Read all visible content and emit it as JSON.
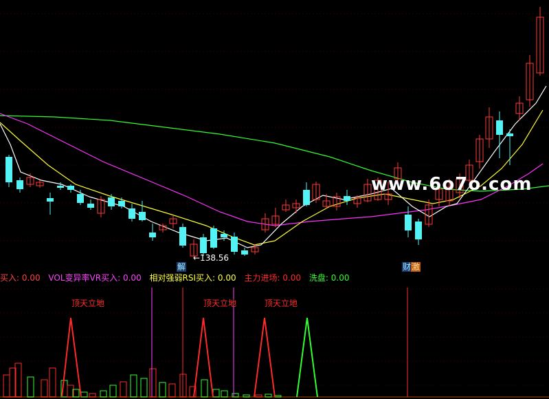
{
  "indicators": {
    "item1": {
      "label": "买入:",
      "value": "0.00"
    },
    "item2": {
      "label": "VOL变异率VR买入:",
      "value": "0.00"
    },
    "item3": {
      "label": "相对强弱RSI买入:",
      "value": "0.00"
    },
    "item4": {
      "label": "主力进场:",
      "value": "0.00"
    },
    "item5": {
      "label": "洗盘:",
      "value": "0.00"
    }
  },
  "markers": {
    "low_price": "←138.56",
    "tag_left": "解",
    "tag_right_1": "财",
    "tag_right_2": "激"
  },
  "signal_labels": [
    "顶天立地",
    "顶天立地",
    "顶天立地"
  ],
  "watermark": "www.6o7o.com",
  "colors": {
    "background": "#000000",
    "up": "#ff3b3b",
    "down": "#53f3f5",
    "ma5": "#ffffff",
    "ma10": "#ffff33",
    "ma20": "#ff33ff",
    "ma60": "#33ff33",
    "grid": "#3a0000"
  }
}
